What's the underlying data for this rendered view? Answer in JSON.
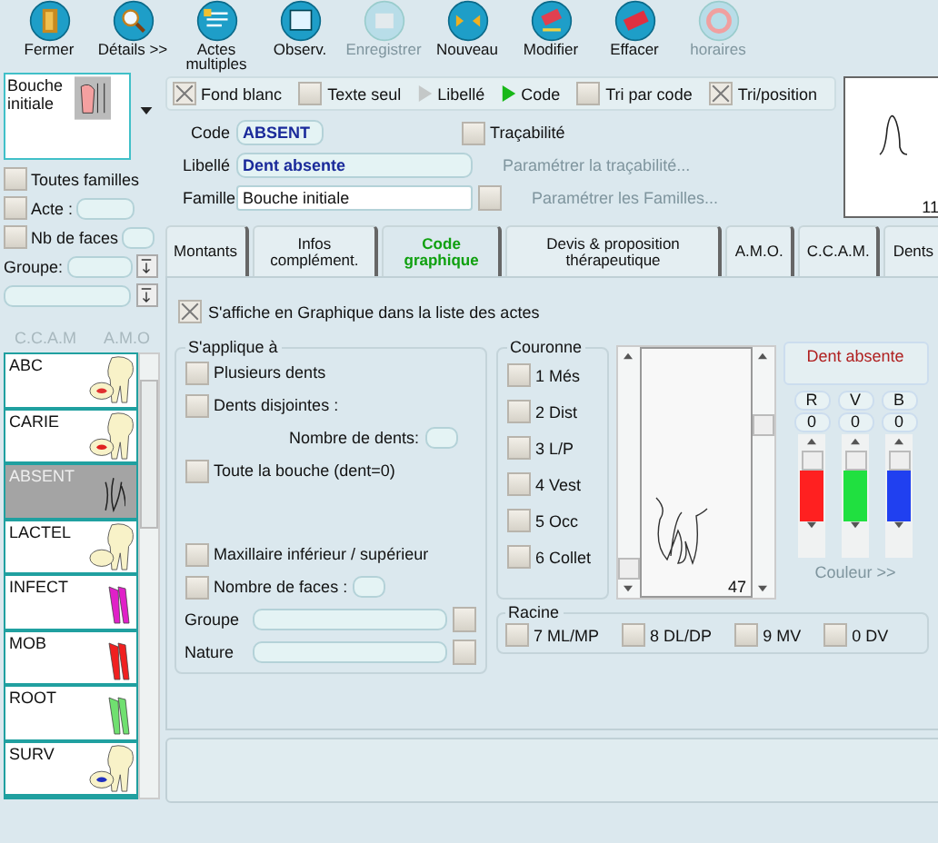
{
  "toolbar": [
    {
      "label": "Fermer",
      "disabled": false
    },
    {
      "label": "Détails >>",
      "disabled": false
    },
    {
      "label": "Actes multiples",
      "disabled": false
    },
    {
      "label": "Observ.",
      "disabled": false
    },
    {
      "label": "Enregistrer",
      "disabled": true
    },
    {
      "label": "Nouveau",
      "disabled": false
    },
    {
      "label": "Modifier",
      "disabled": false
    },
    {
      "label": "Effacer",
      "disabled": false
    },
    {
      "label": "horaires",
      "disabled": true
    }
  ],
  "family_selector": {
    "value": "Bouche initiale"
  },
  "filters": {
    "all_families": {
      "label": "Toutes familles",
      "checked": false
    },
    "act": {
      "label": "Acte :",
      "checked": false
    },
    "faces": {
      "label": "Nb de faces",
      "checked": false
    },
    "group_label": "Groupe:"
  },
  "list_headers": [
    "C.C.A.M",
    "A.M.O"
  ],
  "acts": [
    {
      "label": "ABC",
      "kind": "crown",
      "selected": false,
      "color": "#e03030"
    },
    {
      "label": "CARIE",
      "kind": "crown",
      "selected": false,
      "color": "#e02020"
    },
    {
      "label": "ABSENT",
      "kind": "absent",
      "selected": true
    },
    {
      "label": "LACTEL",
      "kind": "crown",
      "selected": false
    },
    {
      "label": "INFECT",
      "kind": "roots",
      "selected": false,
      "color": "#e020c8"
    },
    {
      "label": "MOB",
      "kind": "roots",
      "selected": false,
      "color": "#f02020"
    },
    {
      "label": "ROOT",
      "kind": "roots",
      "selected": false,
      "color": "#70e070"
    },
    {
      "label": "SURV",
      "kind": "crown",
      "selected": false,
      "color": "#2030c0"
    }
  ],
  "options": [
    {
      "label": "Fond blanc",
      "kind": "checkbox",
      "on": true
    },
    {
      "label": "Texte seul",
      "kind": "checkbox",
      "on": false
    },
    {
      "label": "Libellé",
      "kind": "radio",
      "on": false
    },
    {
      "label": "Code",
      "kind": "radio",
      "on": true
    },
    {
      "label": "Tri par code",
      "kind": "checkbox",
      "on": false
    },
    {
      "label": "Tri/position",
      "kind": "checkbox",
      "on": true
    }
  ],
  "preview": {
    "number": "11"
  },
  "form": {
    "code": {
      "label": "Code",
      "value": "ABSENT"
    },
    "label": {
      "label": "Libellé",
      "value": "Dent absente"
    },
    "family": {
      "label": "Famille",
      "value": "Bouche initiale"
    },
    "traceability": {
      "label": "Traçabilité",
      "checked": false
    },
    "traceability_link": {
      "label": "Paramétrer la traçabilité...",
      "disabled": true
    },
    "families_link": {
      "label": "Paramétrer les Familles...",
      "disabled": true
    }
  },
  "tabs": [
    {
      "label": "Montants",
      "selected": false
    },
    {
      "label": "Infos complément.",
      "selected": false
    },
    {
      "label": "Code graphique",
      "selected": true
    },
    {
      "label": "Devis & proposition thérapeutique",
      "selected": false
    },
    {
      "label": "A.M.O.",
      "selected": false
    },
    {
      "label": "C.C.A.M.",
      "selected": false
    },
    {
      "label": "Dents",
      "selected": false
    }
  ],
  "graphic_display": {
    "label": "S'affiche en Graphique dans la liste des actes",
    "checked": true
  },
  "applies_to": {
    "title": "S'applique à",
    "options": [
      {
        "label": "Plusieurs dents",
        "checked": false
      },
      {
        "label": "Dents disjointes :",
        "checked": false
      },
      {
        "label": "Toute la bouche (dent=0)",
        "checked": false
      },
      {
        "label": "Maxillaire inférieur / supérieur",
        "checked": false
      },
      {
        "label": "Nombre de faces :",
        "checked": false
      }
    ],
    "teeth_count_label": "Nombre de dents:",
    "group_label": "Groupe",
    "nature_label": "Nature"
  },
  "crown": {
    "title": "Couronne",
    "faces": [
      {
        "label": "1 Més",
        "checked": false
      },
      {
        "label": "2 Dist",
        "checked": false
      },
      {
        "label": "3 L/P",
        "checked": false
      },
      {
        "label": "4 Vest",
        "checked": false
      },
      {
        "label": "5 Occ",
        "checked": false
      },
      {
        "label": "6 Collet",
        "checked": false
      }
    ]
  },
  "drawing": {
    "number": "47"
  },
  "color_panel": {
    "name": "Dent absente",
    "channels": [
      {
        "label": "R",
        "value": "0",
        "color": "#ff2020"
      },
      {
        "label": "V",
        "value": "0",
        "color": "#20e040"
      },
      {
        "label": "B",
        "value": "0",
        "color": "#2040f0"
      }
    ],
    "button": {
      "label": "Couleur >>",
      "disabled": true
    }
  },
  "root": {
    "title": "Racine",
    "faces": [
      {
        "label": "7 ML/MP",
        "checked": false
      },
      {
        "label": "8 DL/DP",
        "checked": false
      },
      {
        "label": "9 MV",
        "checked": false
      },
      {
        "label": "0 DV",
        "checked": false
      }
    ]
  }
}
